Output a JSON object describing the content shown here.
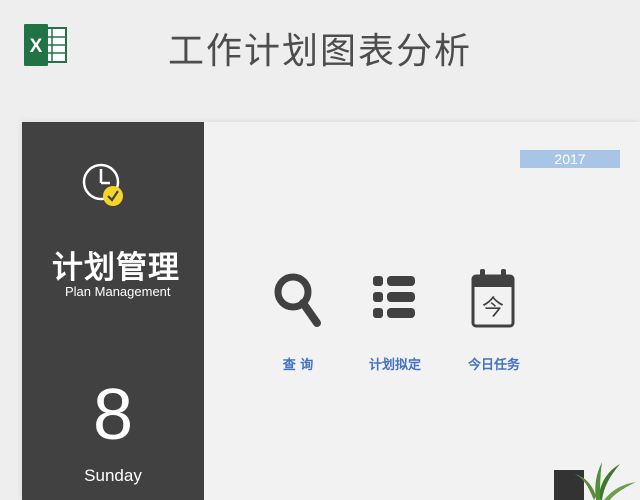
{
  "header": {
    "title": "工作计划图表分析",
    "logo_icon": "excel-logo-icon",
    "logo_letter": "X"
  },
  "sidebar": {
    "title": "计划管理",
    "subtitle": "Plan Management",
    "day_number": "8",
    "day_name": "Sunday",
    "clock_icon": "clock-check-icon"
  },
  "main": {
    "year": "2017",
    "actions": [
      {
        "label": "查 询",
        "icon": "search-icon"
      },
      {
        "label": "计划拟定",
        "icon": "list-icon"
      },
      {
        "label": "今日任务",
        "icon": "calendar-icon",
        "icon_text": "今"
      }
    ]
  },
  "colors": {
    "sidebar_bg": "#414141",
    "accent_blue": "#4472c4",
    "year_badge": "#a9c5e6",
    "clock_check": "#f5d527",
    "excel_green": "#217346"
  }
}
